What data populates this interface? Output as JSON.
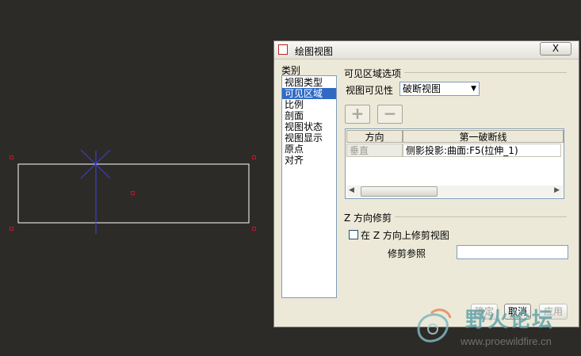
{
  "dialog": {
    "title": "绘图视图",
    "close_label": "X"
  },
  "categories": {
    "label": "类别",
    "items": [
      "视图类型",
      "可见区域",
      "比例",
      "剖面",
      "视图状态",
      "视图显示",
      "原点",
      "对齐"
    ],
    "selected": "可见区域"
  },
  "visible_area": {
    "group_title": "可见区域选项",
    "visibility_label": "视图可见性",
    "visibility_value": "破断视图",
    "add_icon": "plus-icon",
    "remove_icon": "minus-icon",
    "table": {
      "columns": [
        "方向",
        "第一破断线"
      ],
      "rows": [
        {
          "direction": "垂直",
          "first_break": "侧影投影:曲面:F5(拉伸_1)"
        }
      ]
    }
  },
  "z_clip": {
    "group_title": "Z 方向修剪",
    "checkbox_label": "在 Z 方向上修剪视图",
    "checked": false,
    "ref_label": "修剪参照",
    "ref_value": ""
  },
  "buttons": {
    "ok": "确定",
    "cancel": "取消",
    "apply": "应用"
  },
  "watermark": {
    "text": "野火论坛",
    "url": "www.proewildfire.cn"
  },
  "colors": {
    "canvas_bg": "#2d2b27",
    "selection": "#316ac5",
    "view_outline": "#ffffff",
    "view_marker": "#c0152a",
    "axis_lines": "#3d3dc8"
  }
}
